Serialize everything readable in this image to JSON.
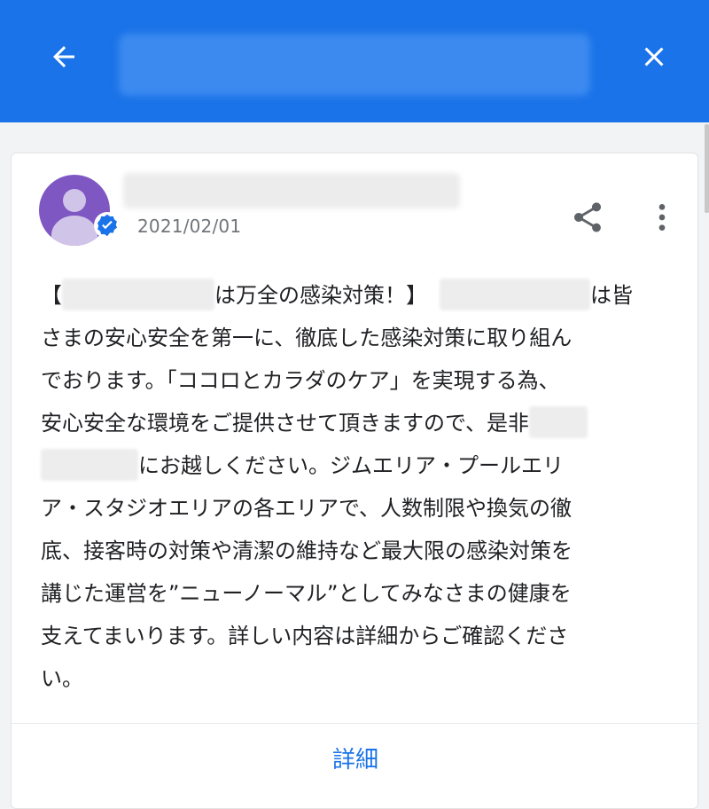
{
  "header": {
    "back_icon": "arrow-left-icon",
    "close_icon": "close-icon",
    "background_color": "#1a73e8"
  },
  "post": {
    "author_avatar_icon": "person-avatar-icon",
    "verified_icon": "verified-badge-icon",
    "date": "2021/02/01",
    "share_icon": "share-icon",
    "more_icon": "more-vert-icon",
    "body": {
      "l1_a": "【",
      "l1_b": "は万全の感染対策！】",
      "l1_c": "は皆",
      "l2": "さまの安心安全を第一に、徹底した感染対策に取り組ん",
      "l3": "でおります。「ココロとカラダのケア」を実現する為、",
      "l4": "安心安全な環境をご提供させて頂きますので、是非",
      "l5": "にお越しください。ジムエリア・プールエリ",
      "l6": "ア・スタジオエリアの各エリアで、人数制限や換気の徹",
      "l7": "底、接客時の対策や清潔の維持など最大限の感染対策を",
      "l8": "講じた運営を”ニューノーマル”としてみなさまの健康を",
      "l9": "支えてまいります。詳しい内容は詳細からご確認くださ",
      "l10": "い。"
    },
    "details_label": "詳細"
  },
  "colors": {
    "accent": "#1a73e8",
    "avatar": "#7e57c2"
  }
}
